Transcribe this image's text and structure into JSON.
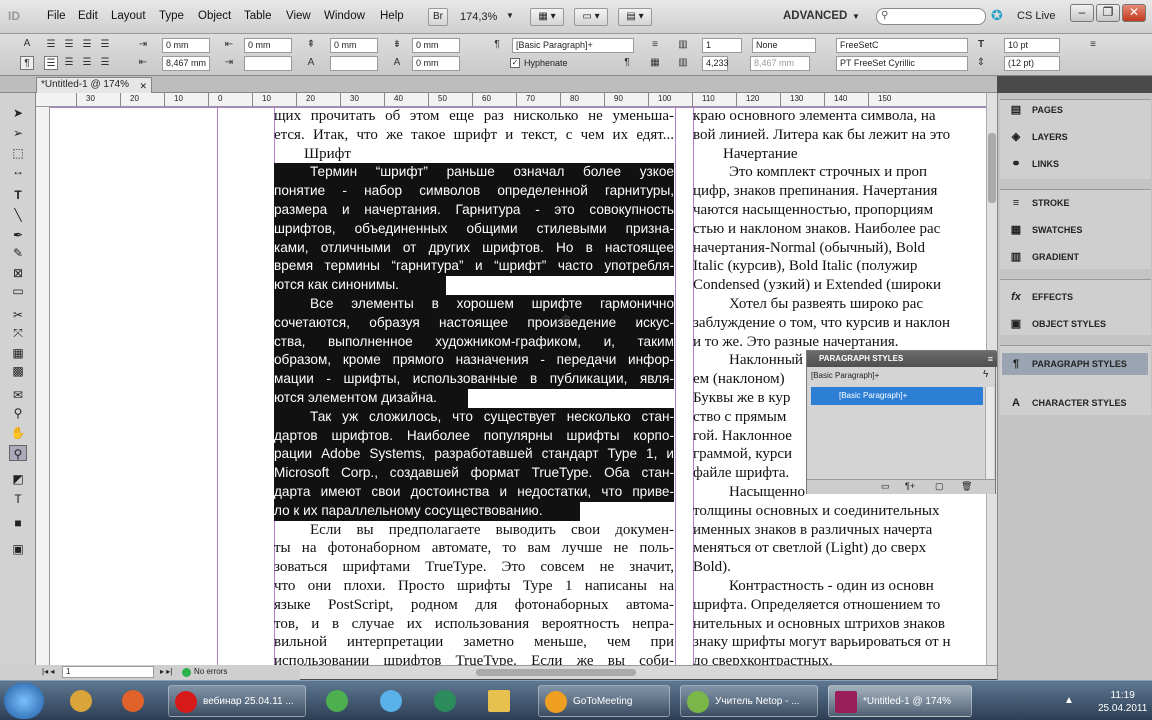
{
  "app": {
    "logo": "ID",
    "workspace": "ADVANCED",
    "cslive": "CS Live",
    "zoom": "174,3%",
    "bridge": "Br"
  },
  "menu": [
    "File",
    "Edit",
    "Layout",
    "Type",
    "Object",
    "Table",
    "View",
    "Window",
    "Help"
  ],
  "control": {
    "indent_left": "0 mm",
    "indent_right": "0 mm",
    "first_indent": "8,467 mm",
    "space_before": "0 mm",
    "space_after": "0 mm",
    "drop_lines": "0 mm",
    "drop_chars": "0 mm",
    "para_style": "[Basic Paragraph]+",
    "hyphenate": "Hyphenate",
    "columns": "1",
    "gutter": "4,233",
    "gutter2": "8,467 mm",
    "align_grid": "None",
    "font_family": "FreeSetC",
    "font_style": "PT FreeSet Cyrillic",
    "font_size": "10 pt",
    "leading": "(12 pt)"
  },
  "document": {
    "tab": "*Untitled-1 @ 174%"
  },
  "ruler": [
    "30",
    "20",
    "10",
    "0",
    "10",
    "20",
    "30",
    "40",
    "50",
    "60",
    "70",
    "80",
    "90",
    "100",
    "110",
    "120",
    "130",
    "140",
    "150"
  ],
  "col1": [
    "щих прочитать об этом еще раз нисколько не уменьша-",
    "ется. Итак, что же такое шрифт и текст, с чем их едят...",
    "Шрифт",
    "Термин “шрифт” раньше означал более узкое",
    "понятие - набор символов определенной гарнитуры,",
    "размера и начертания. Гарнитура - это совокупность",
    "шрифтов, объединенных общими стилевыми призна-",
    "ками, отличными от других шрифтов. Но в настоящее",
    "время термины “гарнитура” и “шрифт” часто употребля-",
    "ются как синонимы.",
    "Все элементы в хорошем шрифте гармонично",
    "сочетаются, образуя настоящее произведение искус-",
    "ства, выполненное художником-графиком, и, таким",
    "образом, кроме прямого назначения - передачи инфор-",
    "мации - шрифты, использованные в публикации, явля-",
    "ются элементом дизайна.",
    "Так уж сложилось, что существует несколько стан-",
    "дартов шрифтов. Наиболее популярны шрифты корпо-",
    "рации Adobe Systems, разработавшей стандарт Type 1, и",
    "Microsoft Corp., создавшей формат TrueType. Оба стан-",
    "дарта имеют свои достоинства и недостатки, что приве-",
    "ло к их параллельному сосуществованию.",
    "Если вы предполагаете выводить свои докумен-",
    "ты на фотонаборном автомате, то вам лучше не поль-",
    "зоваться шрифтами TrueType. Это совсем не значит,",
    "что они плохи. Просто шрифты Type 1 написаны на",
    "языке PostScript, родном для фотонаборных автома-",
    "тов, и в случае их использования вероятность непра-",
    "вильной интерпретации заметно меньше, чем при",
    "использовании шрифтов TrueType. Если же вы соби-"
  ],
  "col2": [
    "краю основного элемента символа, на",
    "вой линией. Литера как бы лежит на это",
    "Начертание",
    "Это комплект строчных и проп",
    "цифр, знаков препинания. Начертания",
    "чаются насыщенностью, пропорциям",
    "стью и наклоном знаков. Наиболее рас",
    "начертания-Normal (обычный), Bold",
    "Italic (курсив), Bold Italic (полужир",
    "Condensed (узкий) и Extended (широки",
    "Хотел бы развеять широко рас",
    "заблуждение о том, что курсив и наклон",
    "и то же. Это разные начертания.",
    "Наклонный",
    "ем (наклоном)",
    "Буквы же в кур",
    "ство с прямым",
    "гой. Наклонное",
    "граммой, курси",
    "файле шрифта.",
    "Насыщенно",
    "толщины основных и соединительных",
    "именных знаков в различных начерта",
    "меняться от светлой (Light) до сверх",
    "Bold).",
    "Контрастность - один из основн",
    "шрифта. Определяется отношением то",
    "нительных и основных штрихов знаков",
    "знаку шрифты могут варьироваться от н",
    "до сверхконтрастных."
  ],
  "panels": [
    {
      "label": "PAGES",
      "icon": "pages-icon"
    },
    {
      "label": "LAYERS",
      "icon": "layers-icon"
    },
    {
      "label": "LINKS",
      "icon": "links-icon"
    },
    {
      "label": "STROKE",
      "icon": "stroke-icon"
    },
    {
      "label": "SWATCHES",
      "icon": "swatches-icon"
    },
    {
      "label": "GRADIENT",
      "icon": "gradient-icon"
    },
    {
      "label": "EFFECTS",
      "icon": "effects-icon"
    },
    {
      "label": "OBJECT STYLES",
      "icon": "object-styles-icon"
    },
    {
      "label": "PARAGRAPH STYLES",
      "icon": "paragraph-styles-icon"
    },
    {
      "label": "CHARACTER STYLES",
      "icon": "character-styles-icon"
    }
  ],
  "para_panel": {
    "title": "PARAGRAPH STYLES",
    "current": "[Basic Paragraph]+",
    "item": "[Basic Paragraph]+"
  },
  "status": {
    "page": "1",
    "preflight": "No errors"
  },
  "taskbar": [
    {
      "label": "",
      "icon": "windows-start-icon",
      "color": "#3a8ee6"
    },
    {
      "label": "",
      "icon": "explorer-icon",
      "color": "#d9a43a"
    },
    {
      "label": "",
      "icon": "firefox-icon",
      "color": "#e0622a"
    },
    {
      "label": "вебинар 25.04.11 ...",
      "icon": "opera-icon",
      "color": "#d61a1a"
    },
    {
      "label": "",
      "icon": "chrome-icon",
      "color": "#4caf50"
    },
    {
      "label": "",
      "icon": "safari-icon",
      "color": "#5ab0e8"
    },
    {
      "label": "",
      "icon": "app-icon",
      "color": "#2c8c5c"
    },
    {
      "label": "",
      "icon": "folder-icon",
      "color": "#e8c050"
    },
    {
      "label": "GoToMeeting",
      "icon": "gotomeeting-icon",
      "color": "#f0a020"
    },
    {
      "label": "Учитель Netop - ...",
      "icon": "netop-icon",
      "color": "#7ab648"
    },
    {
      "label": "*Untitled-1 @ 174%",
      "icon": "indesign-icon",
      "color": "#9a1e5a"
    }
  ],
  "clock": {
    "time": "11:19",
    "date": "25.04.2011"
  }
}
